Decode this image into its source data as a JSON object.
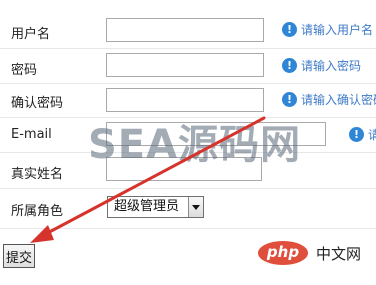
{
  "form": {
    "username": {
      "label": "用户名",
      "value": "",
      "hint": "请输入用户名"
    },
    "password": {
      "label": "密码",
      "value": "",
      "hint": "请输入密码"
    },
    "confirm_password": {
      "label": "确认密码",
      "value": "",
      "hint": "请输入确认密码"
    },
    "email": {
      "label": "E-mail",
      "value": "",
      "hint": "请"
    },
    "real_name": {
      "label": "真实姓名",
      "value": ""
    },
    "role": {
      "label": "所属角色",
      "selected": "超级管理员"
    },
    "submit_label": "提交"
  },
  "watermark": "SEA源码网",
  "logo": {
    "badge": "php",
    "site": "中文网"
  },
  "colors": {
    "hint_icon": "#2f86d6",
    "hint_text": "#3d7bc7",
    "arrow": "#d6332c",
    "php_badge": "#e04e3c"
  },
  "icons": {
    "hint": "info-icon",
    "select": "dropdown-arrow-icon",
    "annotation": "red-arrow-icon"
  }
}
